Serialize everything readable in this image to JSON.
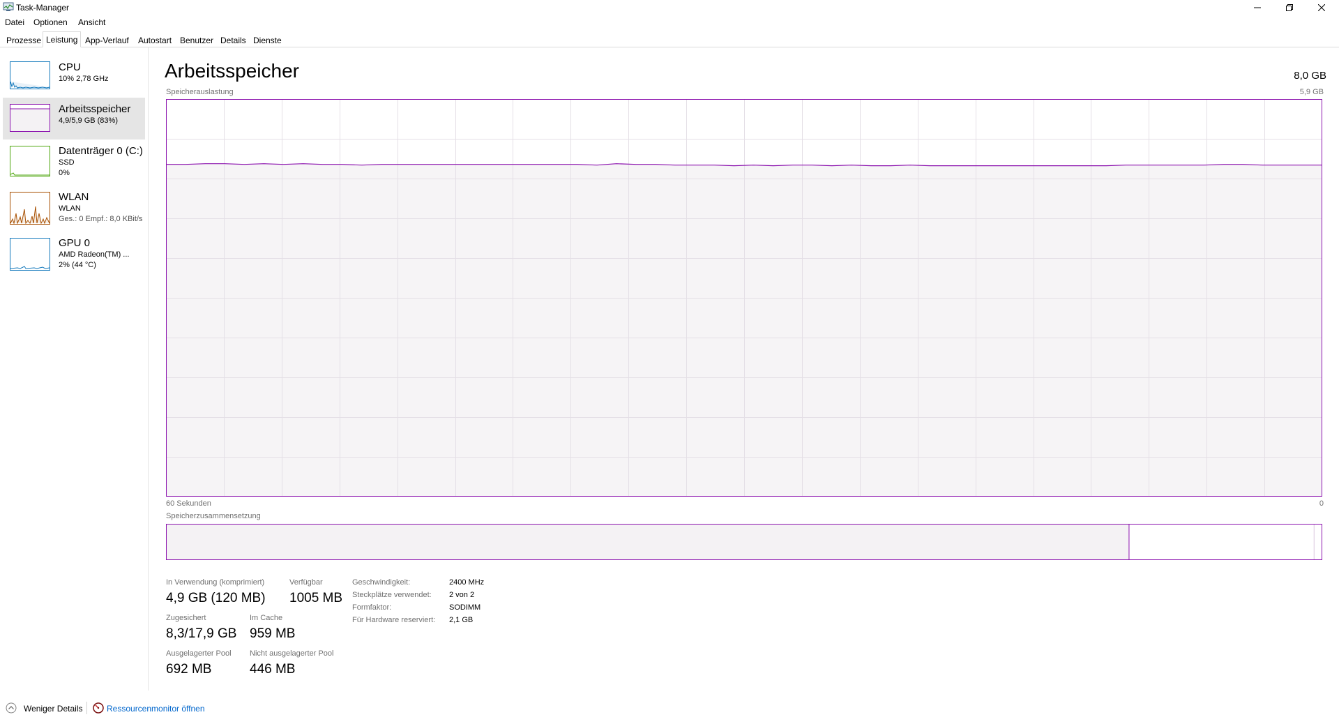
{
  "window": {
    "title": "Task-Manager",
    "controls": {
      "minimize": "minimize-icon",
      "restore": "restore-icon",
      "close": "close-icon"
    }
  },
  "menu": [
    "Datei",
    "Optionen",
    "Ansicht"
  ],
  "tabs": [
    {
      "label": "Prozesse",
      "active": false
    },
    {
      "label": "Leistung",
      "active": true
    },
    {
      "label": "App-Verlauf",
      "active": false
    },
    {
      "label": "Autostart",
      "active": false
    },
    {
      "label": "Benutzer",
      "active": false
    },
    {
      "label": "Details",
      "active": false
    },
    {
      "label": "Dienste",
      "active": false
    }
  ],
  "sidebar": {
    "items": [
      {
        "title": "CPU",
        "lines": [
          "10%  2,78 GHz"
        ],
        "color": "#1177bb",
        "active": false
      },
      {
        "title": "Arbeitsspeicher",
        "lines": [
          "4,9/5,9 GB (83%)"
        ],
        "color": "#8b12ae",
        "active": true
      },
      {
        "title": "Datenträger 0 (C:)",
        "lines": [
          "SSD",
          "0%"
        ],
        "color": "#4da60c",
        "active": false
      },
      {
        "title": "WLAN",
        "lines": [
          "WLAN",
          "Ges.: 0 Empf.: 8,0 KBit/s"
        ],
        "color": "#a74f01",
        "active": false
      },
      {
        "title": "GPU 0",
        "lines": [
          "AMD Radeon(TM) ...",
          "2% (44 °C)"
        ],
        "color": "#1177bb",
        "active": false
      }
    ]
  },
  "main": {
    "title": "Arbeitsspeicher",
    "total": "8,0 GB",
    "usage_label": "Speicherauslastung",
    "usage_max": "5,9 GB",
    "time_left": "60 Sekunden",
    "time_right": "0",
    "composition_label": "Speicherzusammensetzung",
    "accent_color": "#8b12ae",
    "fill_color": "#f4f2f4"
  },
  "chart_data": {
    "type": "area",
    "xlabel": "60 Sekunden",
    "x_range": [
      60,
      0
    ],
    "y_range_gb": [
      0,
      5.9
    ],
    "grid": true,
    "series": [
      {
        "values": [
          4.93,
          4.93,
          4.94,
          4.94,
          4.93,
          4.94,
          4.93,
          4.94,
          4.93,
          4.93,
          4.92,
          4.93,
          4.93,
          4.93,
          4.93,
          4.93,
          4.93,
          4.93,
          4.93,
          4.93,
          4.93,
          4.93,
          4.92,
          4.94,
          4.93,
          4.93,
          4.92,
          4.92,
          4.92,
          4.91,
          4.92,
          4.91,
          4.92,
          4.92,
          4.91,
          4.92,
          4.91,
          4.91,
          4.92,
          4.91,
          4.91,
          4.91,
          4.91,
          4.91,
          4.91,
          4.91,
          4.91,
          4.91,
          4.91,
          4.92,
          4.92,
          4.92,
          4.92,
          4.92,
          4.93,
          4.93,
          4.92,
          4.92,
          4.92,
          4.92
        ]
      }
    ],
    "composition": {
      "in_use_fraction": 0.833,
      "modified_fraction": 0.0,
      "standby_fraction": 0.159,
      "free_fraction": 0.008
    }
  },
  "stats": [
    {
      "label": "In Verwendung (komprimiert)",
      "value": "4,9 GB (120 MB)"
    },
    {
      "label": "Verfügbar",
      "value": "1005 MB"
    },
    {
      "label": "Zugesichert",
      "value": "8,3/17,9 GB"
    },
    {
      "label": "Im Cache",
      "value": "959 MB"
    },
    {
      "label": "Ausgelagerter Pool",
      "value": "692 MB"
    },
    {
      "label": "Nicht ausgelagerter Pool",
      "value": "446 MB"
    }
  ],
  "details": [
    {
      "label": "Geschwindigkeit:",
      "value": "2400 MHz"
    },
    {
      "label": "Steckplätze verwendet:",
      "value": "2 von 2"
    },
    {
      "label": "Formfaktor:",
      "value": "SODIMM"
    },
    {
      "label": "Für Hardware reserviert:",
      "value": "2,1 GB"
    }
  ],
  "footer": {
    "less_details": "Weniger Details",
    "resmon": "Ressourcenmonitor öffnen"
  }
}
